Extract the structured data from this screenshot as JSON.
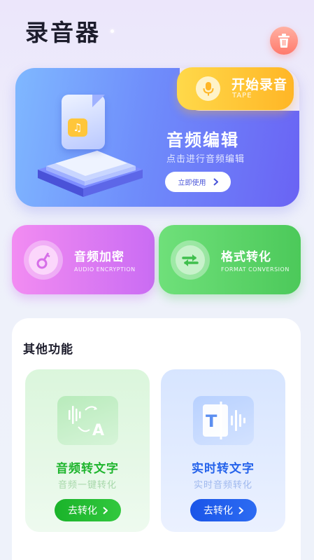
{
  "header": {
    "title": "录音器",
    "trash_icon": "trash-icon"
  },
  "record": {
    "title": "开始录音",
    "subtitle": "TAPE",
    "icon": "microphone-icon"
  },
  "audio_edit": {
    "title": "音频编辑",
    "subtitle": "点击进行音频编辑",
    "button": "立即使用"
  },
  "encryption": {
    "title": "音频加密",
    "subtitle": "AUDIO ENCRYPTION",
    "icon": "key-icon"
  },
  "format": {
    "title": "格式转化",
    "subtitle": "FORMAT CONVERSION",
    "icon": "swap-arrows-icon"
  },
  "other": {
    "title": "其他功能",
    "audio_to_text": {
      "title": "音频转文字",
      "subtitle": "音频一键转化",
      "button": "去转化"
    },
    "realtime_to_text": {
      "title": "实时转文字",
      "subtitle": "实时音频转化",
      "button": "去转化"
    }
  },
  "colors": {
    "green_accent": "#1fb52e",
    "blue_accent": "#2563eb",
    "yellow_button": "#ffc83a"
  }
}
